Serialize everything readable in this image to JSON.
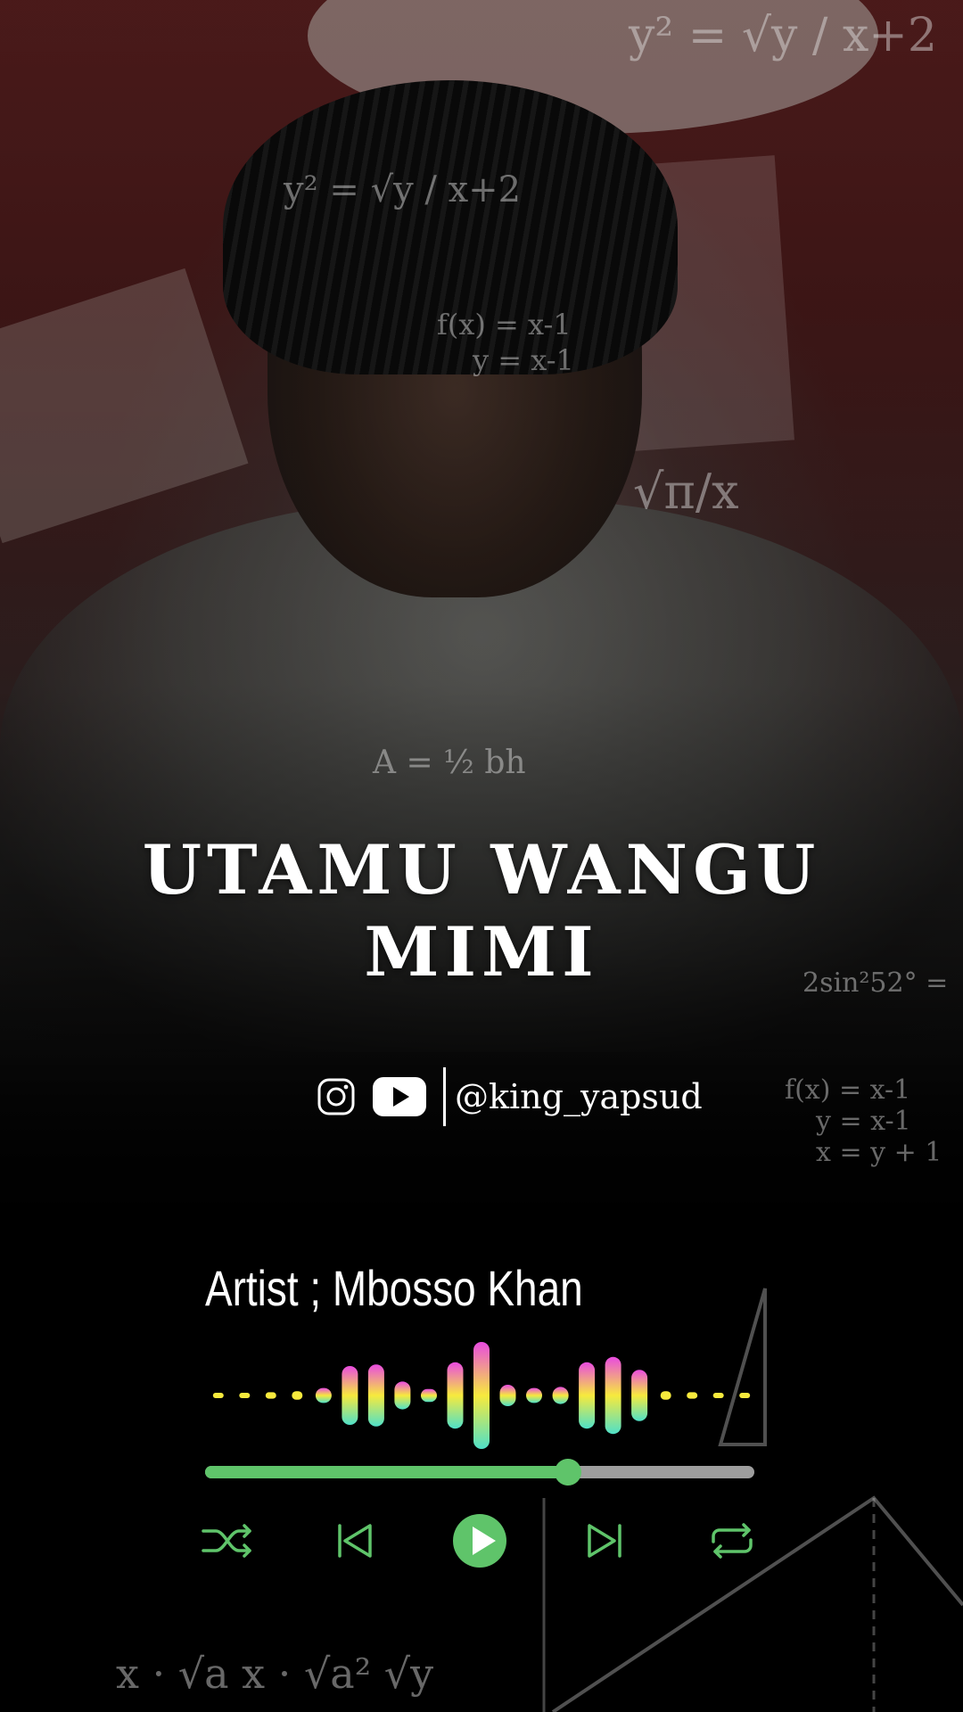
{
  "song": {
    "title_line1": "UTAMU WANGU",
    "title_line2": "MIMI"
  },
  "social": {
    "handle": "@king_yapsud",
    "icons": [
      "instagram-icon",
      "youtube-icon"
    ]
  },
  "artist": {
    "label": "Artist ; Mbosso Khan"
  },
  "player": {
    "progress": 0.66,
    "controls": [
      "shuffle-icon",
      "previous-icon",
      "play-icon",
      "next-icon",
      "repeat-icon"
    ],
    "accent_color": "#5fc46a",
    "track_color": "#9e9e9e",
    "equalizer_levels": [
      0.02,
      0.04,
      0.06,
      0.08,
      0.14,
      0.55,
      0.58,
      0.26,
      0.12,
      0.62,
      1.0,
      0.2,
      0.14,
      0.16,
      0.62,
      0.72,
      0.48,
      0.08,
      0.06,
      0.04,
      0.02
    ],
    "equalizer_colors": [
      "#e94be0",
      "#f7ea3d",
      "#4fe0c8"
    ]
  },
  "background_text": {
    "formulas": [
      "y² = √y / x+2",
      "y² = √y / x+2",
      "f(x) = x-1",
      "y = x-1",
      "√π/x",
      "A = ½ bh",
      "2sin²52° =",
      "f(x) = x-1",
      "y = x-1",
      "x = y + 1",
      "x · √a  x · √a²  √y"
    ]
  }
}
